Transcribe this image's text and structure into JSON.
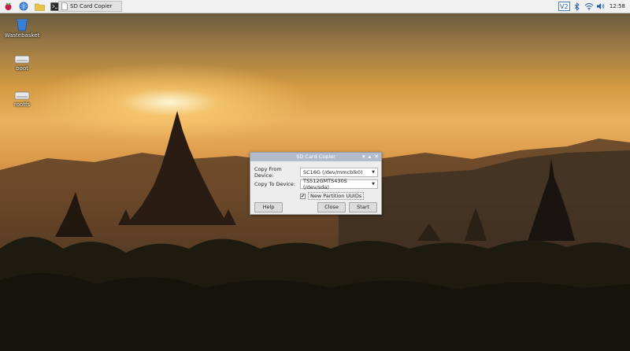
{
  "taskbar": {
    "window_button_label": "SD Card Copier",
    "clock": "12:58"
  },
  "desktop": {
    "icons": [
      {
        "label": "Wastebasket",
        "icon": "trash-icon"
      },
      {
        "label": "boot",
        "icon": "drive-icon"
      },
      {
        "label": "rootfs",
        "icon": "drive-icon"
      }
    ]
  },
  "dialog": {
    "title": "SD Card Copier",
    "copy_from_label": "Copy From Device:",
    "copy_from_value": "SC16G  (/dev/mmcblk0)",
    "copy_to_label": "Copy To Device:",
    "copy_to_value": "TS512GMTS430S  (/dev/sda)",
    "new_uuids_label": "New Partition UUIDs",
    "new_uuids_checked": true,
    "help_label": "Help",
    "close_label": "Close",
    "start_label": "Start"
  },
  "colors": {
    "panel": "#f1f1f1",
    "titlebar": "#b3bccd",
    "dialog_bg": "#ededed"
  }
}
